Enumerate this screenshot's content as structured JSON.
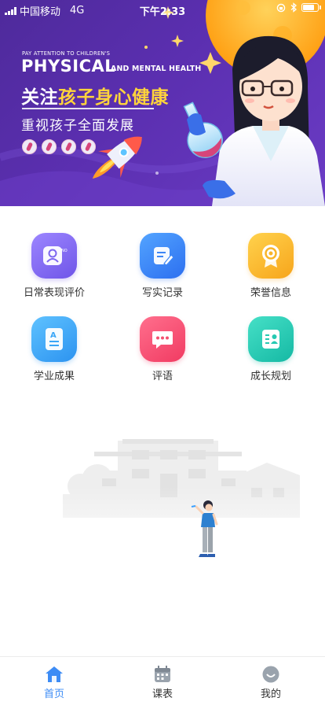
{
  "status_bar": {
    "carrier": "中国移动",
    "network": "4G",
    "time": "下午2:33"
  },
  "banner": {
    "small_line": "PAY ATTENTION TO CHILDREN'S",
    "big_word": "PHYSICAL",
    "big_suffix": "AND MENTAL HEALTH",
    "title_prefix": "关注",
    "title_highlight": "孩子身心健康",
    "subtitle": "重视孩子全面发展",
    "colors": {
      "background": "#5b2fb0",
      "highlight": "#ffd43b",
      "sun": "#ffb21e"
    }
  },
  "grid": [
    {
      "label": "日常表现评价",
      "icon": "profile-card-icon",
      "color": "#7d66f0"
    },
    {
      "label": "写实记录",
      "icon": "note-pen-icon",
      "color": "#3d86f6"
    },
    {
      "label": "荣誉信息",
      "icon": "medal-icon",
      "color": "#f9b52a"
    },
    {
      "label": "学业成果",
      "icon": "grade-document-icon",
      "color": "#3aa6f7"
    },
    {
      "label": "评语",
      "icon": "chat-bubble-icon",
      "color": "#f4506f"
    },
    {
      "label": "成长规划",
      "icon": "contact-card-icon",
      "color": "#26c9b2"
    }
  ],
  "tabs": [
    {
      "label": "首页",
      "icon": "home-icon",
      "active": true
    },
    {
      "label": "课表",
      "icon": "calendar-icon",
      "active": false
    },
    {
      "label": "我的",
      "icon": "user-face-icon",
      "active": false
    }
  ],
  "accent_color": "#3d8cf5"
}
